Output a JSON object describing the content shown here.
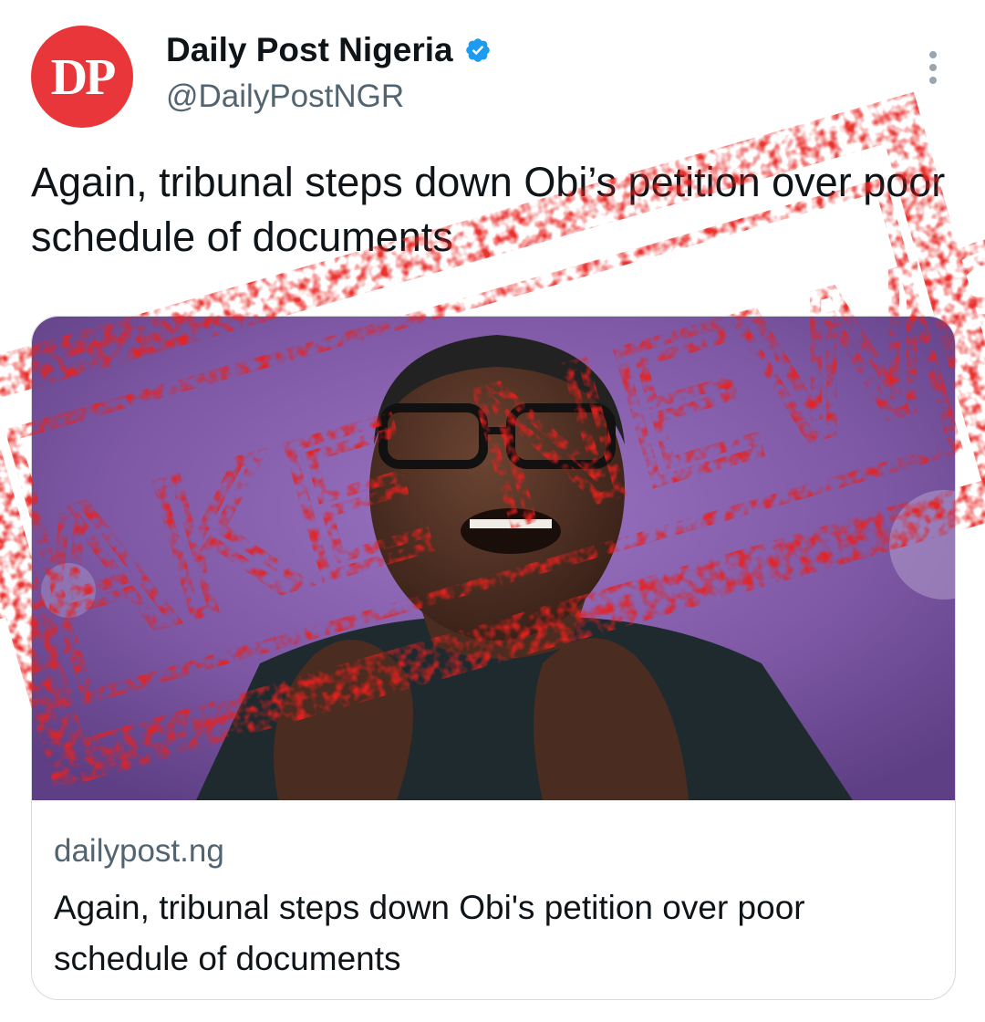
{
  "account": {
    "avatar_text": "DP",
    "display_name": "Daily Post Nigeria",
    "handle": "@DailyPostNGR",
    "verified_icon": "verified-badge-icon"
  },
  "tweet": {
    "text": "Again, tribunal steps down Obi’s petition over poor schedule of documents"
  },
  "link_card": {
    "domain": "dailypost.ng",
    "title": "Again, tribunal steps down Obi's petition over poor schedule of documents",
    "image_icon": "news-photo-image"
  },
  "stamp": {
    "text": "FAKE NEWS",
    "color": "#e8211e"
  },
  "colors": {
    "avatar_bg": "#e8363a",
    "verified": "#1d9bf0",
    "secondary_text": "#536471",
    "photo_bg": "#7e58a4"
  }
}
